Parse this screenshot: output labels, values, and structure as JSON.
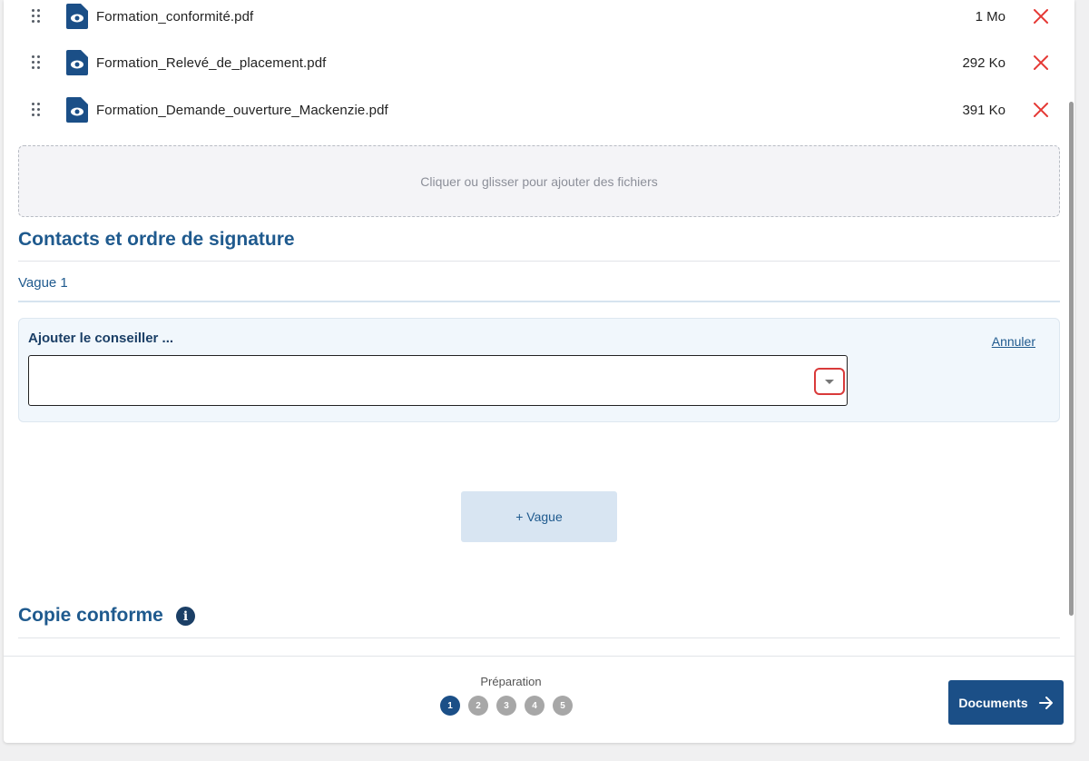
{
  "files": [
    {
      "name": "Formation_conformité.pdf",
      "size": "1 Mo"
    },
    {
      "name": "Formation_Relevé_de_placement.pdf",
      "size": "292 Ko"
    },
    {
      "name": "Formation_Demande_ouverture_Mackenzie.pdf",
      "size": "391 Ko"
    }
  ],
  "icons": {
    "drag": "drag-handle-icon",
    "file": "file-eye-icon",
    "remove": "close-icon",
    "info": "info-icon",
    "next": "arrow-right-icon",
    "dropdown": "caret-down-icon"
  },
  "dropzone": {
    "label": "Cliquer ou glisser pour ajouter des fichiers"
  },
  "contacts": {
    "title": "Contacts et ordre de signature",
    "wave_label": "Vague 1",
    "add_label": "Ajouter le conseiller ...",
    "cancel_label": "Annuler",
    "select_value": "",
    "add_wave_label": "+ Vague"
  },
  "copy": {
    "title": "Copie conforme",
    "info_glyph": "i"
  },
  "footer": {
    "step_label": "Préparation",
    "steps": [
      "1",
      "2",
      "3",
      "4",
      "5"
    ],
    "active_step": 1,
    "next_label": "Documents"
  },
  "colors": {
    "primary": "#1b4f87",
    "title": "#1f5a8e",
    "remove": "#e53935",
    "highlight": "#d93a3a"
  }
}
